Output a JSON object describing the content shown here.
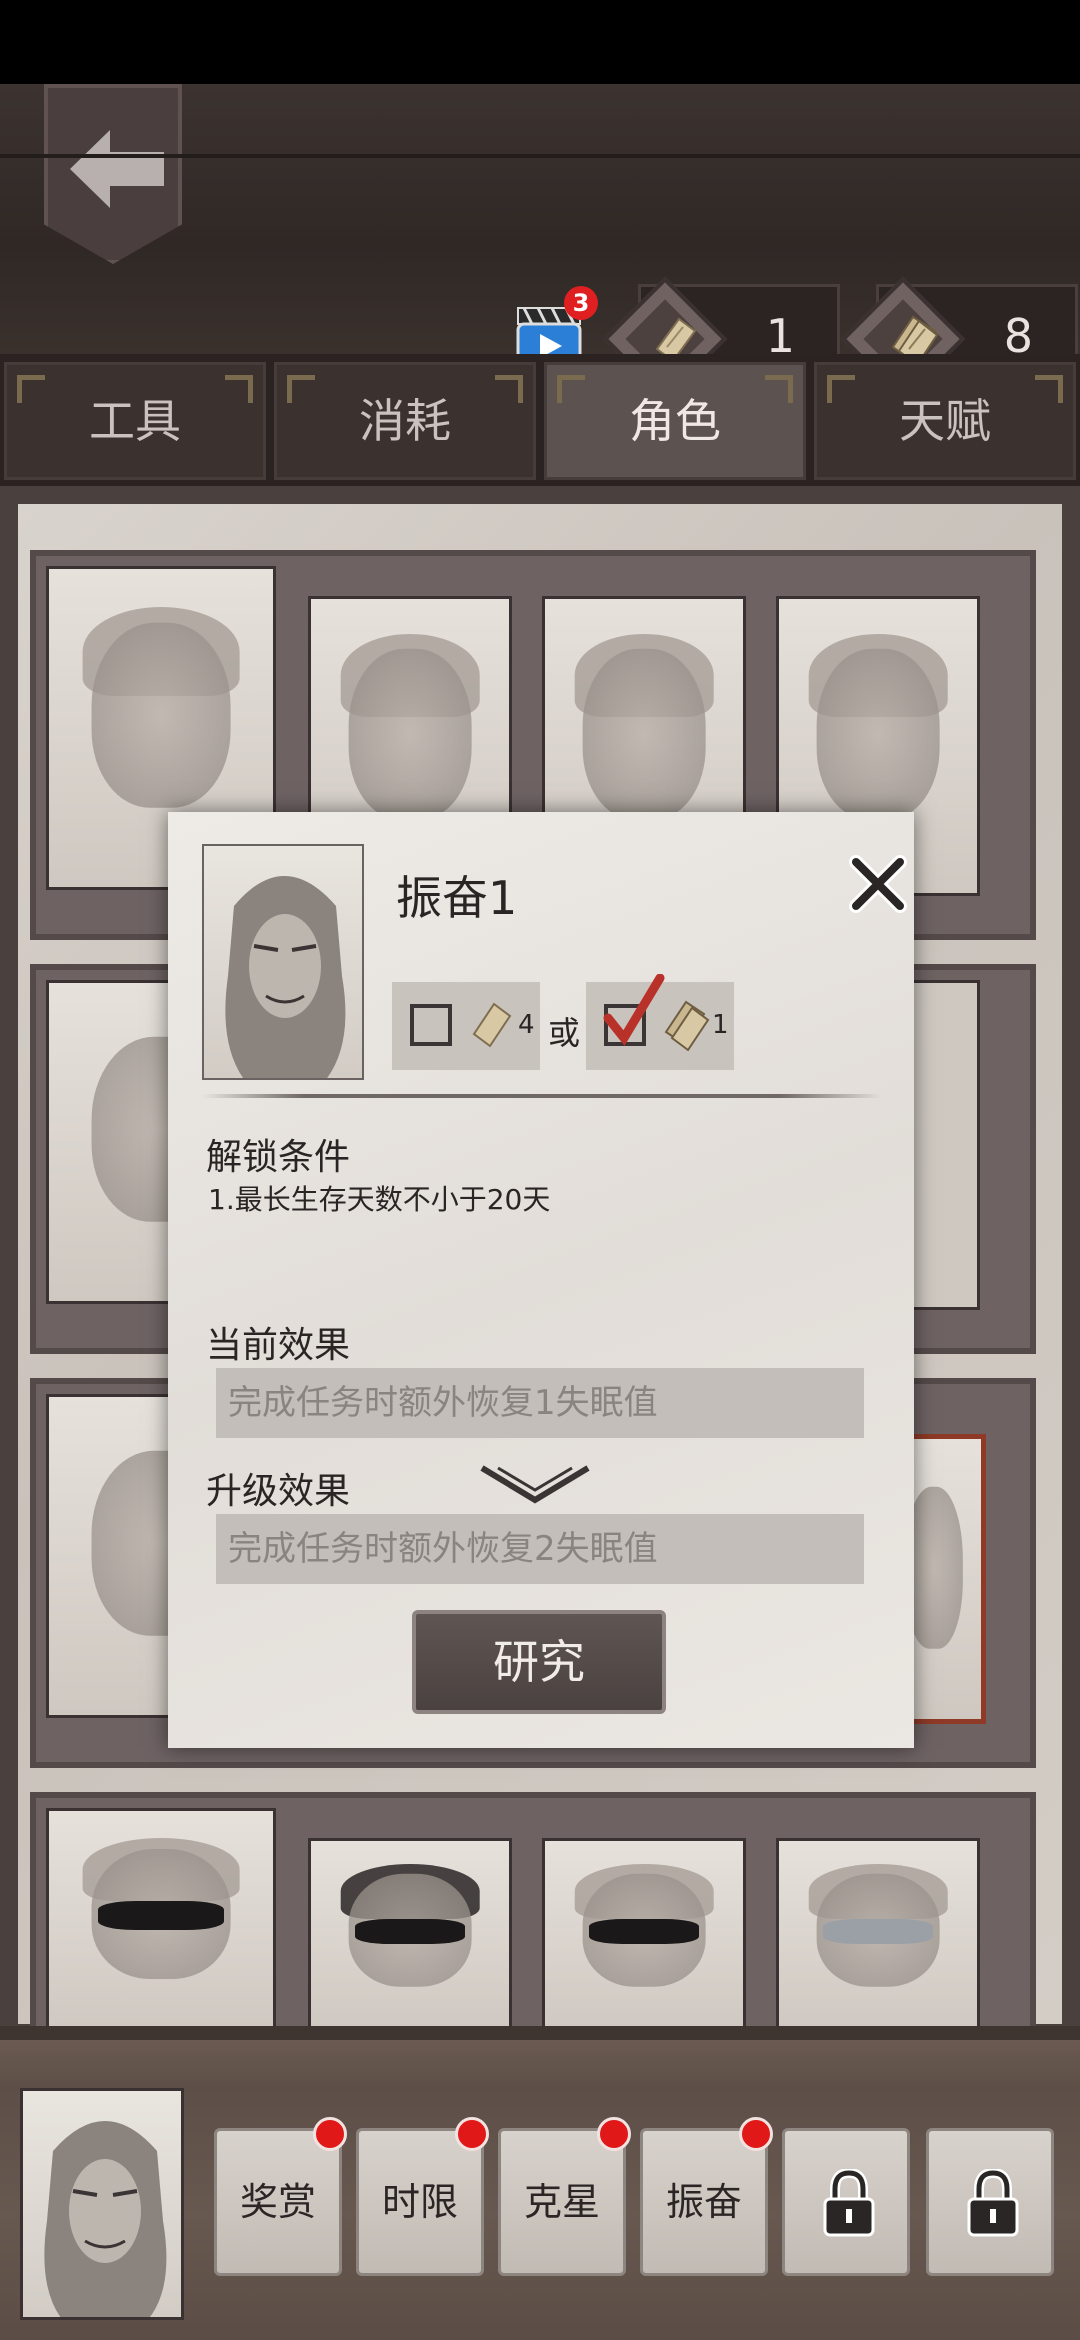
{
  "header": {
    "video_badge": "3",
    "currency_1": "1",
    "currency_2": "8"
  },
  "tabs": [
    {
      "label": "工具",
      "active": false
    },
    {
      "label": "消耗",
      "active": false
    },
    {
      "label": "角色",
      "active": true
    },
    {
      "label": "天赋",
      "active": false
    }
  ],
  "dialog": {
    "title": "振奋1",
    "cost_option_1": "4",
    "or_label": "或",
    "cost_option_2": "1",
    "cost_option_2_checked": true,
    "unlock_label": "解锁条件",
    "unlock_condition": "1.最长生存天数不小于20天",
    "current_effect_label": "当前效果",
    "current_effect": "完成任务时额外恢复1失眠值",
    "upgrade_effect_label": "升级效果",
    "upgrade_effect": "完成任务时额外恢复2失眠值",
    "research_label": "研究"
  },
  "skills": [
    {
      "label": "奖赏",
      "notify": true
    },
    {
      "label": "时限",
      "notify": true
    },
    {
      "label": "克星",
      "notify": true
    },
    {
      "label": "振奋",
      "notify": true
    },
    {
      "label": "",
      "locked": true
    },
    {
      "label": "",
      "locked": true
    }
  ],
  "icons": {
    "back": "back-arrow-icon",
    "video": "video-ad-icon",
    "paper": "paper-scroll-icon",
    "bundle": "paper-bundle-icon",
    "close": "close-icon",
    "chevron": "chevron-down-icon",
    "lock": "lock-icon"
  },
  "colors": {
    "badge_red": "#e02020",
    "check_red": "#b8322a",
    "highlight_frame": "#8e3a26"
  }
}
